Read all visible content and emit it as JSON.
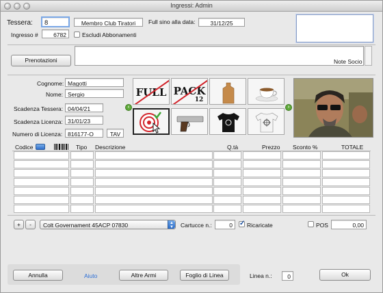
{
  "window": {
    "title": "Ingressi: Admin"
  },
  "top": {
    "tessera_label": "Tessera:",
    "tessera_value": "8",
    "membership_type": "Membro Club Tiratori",
    "full_until_label": "Full sino alla data:",
    "full_until_value": "31/12/25",
    "ingresso_label": "Ingresso #",
    "ingresso_value": "6782",
    "exclude_label": "Escludi Abbonamenti",
    "exclude_checked": false,
    "prenotazioni_button": "Prenotazioni",
    "note_socio_label": "Note Socio"
  },
  "member": {
    "cognome_label": "Cognome:",
    "cognome_value": "Magotti",
    "nome_label": "Nome:",
    "nome_value": "Sergio",
    "scad_tessera_label": "Scadenza Tessera:",
    "scad_tessera_value": "04/04/21",
    "scad_licenza_label": "Scadenza Licenza:",
    "scad_licenza_value": "31/01/23",
    "num_licenza_label": "Numero di Licenza:",
    "num_licenza_value": "816177-O",
    "licenza_tipo": "TAV"
  },
  "tiles": {
    "full_word": "FULL",
    "pack_word": "PACK",
    "pack_number": "12"
  },
  "table": {
    "columns": [
      "Codice",
      "Tipo",
      "Descrizione",
      "Q.tà",
      "Prezzo",
      "Sconto %",
      "TOTALE"
    ],
    "row_count": 7
  },
  "bottom_bar": {
    "add_label": "+",
    "remove_label": "-",
    "weapon_selected": "Colt Governament 45ACP 07830",
    "cartucce_label": "Cartucce n.:",
    "cartucce_value": "0",
    "ricaricate_label": "Ricaricate",
    "ricaricate_checked": true,
    "pos_label": "POS",
    "pos_checked": false,
    "pos_amount": "0,00"
  },
  "footer": {
    "annulla": "Annulla",
    "aiuto": "Aiuto",
    "altre_armi": "Altre Armi",
    "foglio_di_linea": "Foglio di Linea",
    "linea_label": "Linea n.:",
    "linea_value": "0",
    "ok": "Ok"
  },
  "colors": {
    "link_blue": "#2b6ed6",
    "slash_red": "#d2232a",
    "nav_green": "#5fa93a"
  }
}
